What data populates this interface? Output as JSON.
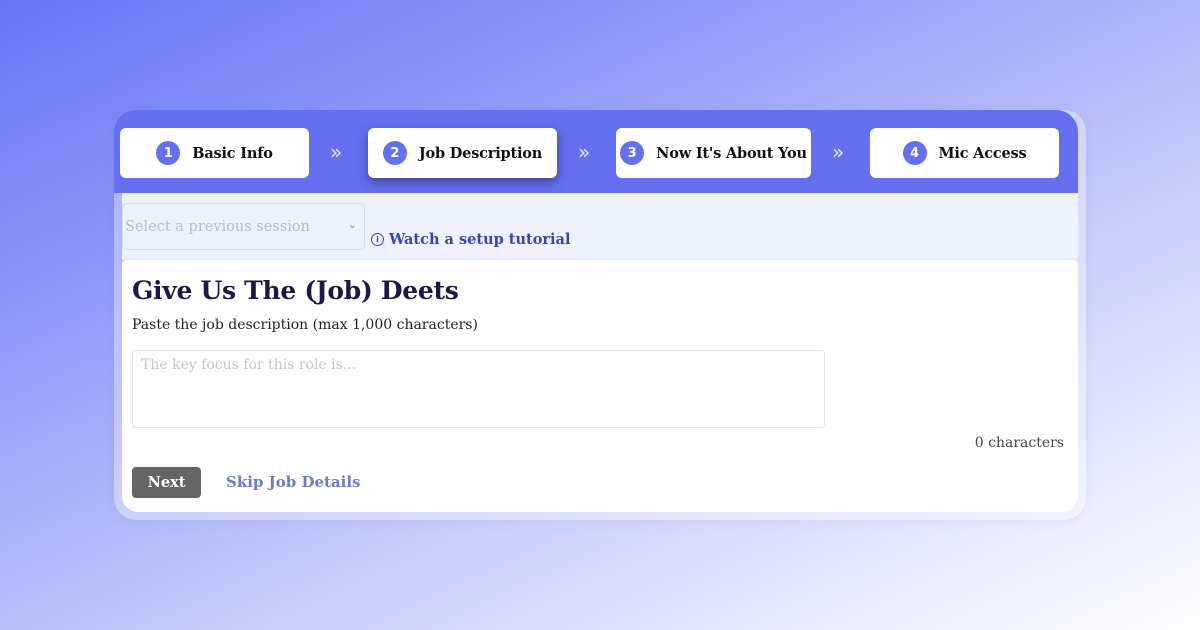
{
  "stepper": {
    "steps": [
      {
        "number": "1",
        "label": "Basic Info",
        "active": false
      },
      {
        "number": "2",
        "label": "Job Description",
        "active": true
      },
      {
        "number": "3",
        "label": "Now It's About You",
        "active": false
      },
      {
        "number": "4",
        "label": "Mic Access",
        "active": false
      }
    ],
    "separator_icon": "double-chevron-right-icon",
    "separator_glyph": "»"
  },
  "session": {
    "select_placeholder": "Select a previous session",
    "caret_glyph": "⌄",
    "tutorial_icon": "info-circle-icon",
    "tutorial_icon_glyph": "i",
    "tutorial_label": "Watch a setup tutorial"
  },
  "form": {
    "title": "Give Us The (Job) Deets",
    "subtitle": "Paste the job description (max 1,000 characters)",
    "textarea_placeholder": "The key focus for this role is...",
    "textarea_value": "",
    "char_count": "0 characters",
    "next_label": "Next",
    "skip_label": "Skip Job Details"
  },
  "colors": {
    "accent": "#6470f0",
    "title": "#1c1a44",
    "link": "#3a44b3",
    "skip_link": "#6f79c9",
    "next_button": "#656565",
    "session_bar": "#eef2fd"
  }
}
